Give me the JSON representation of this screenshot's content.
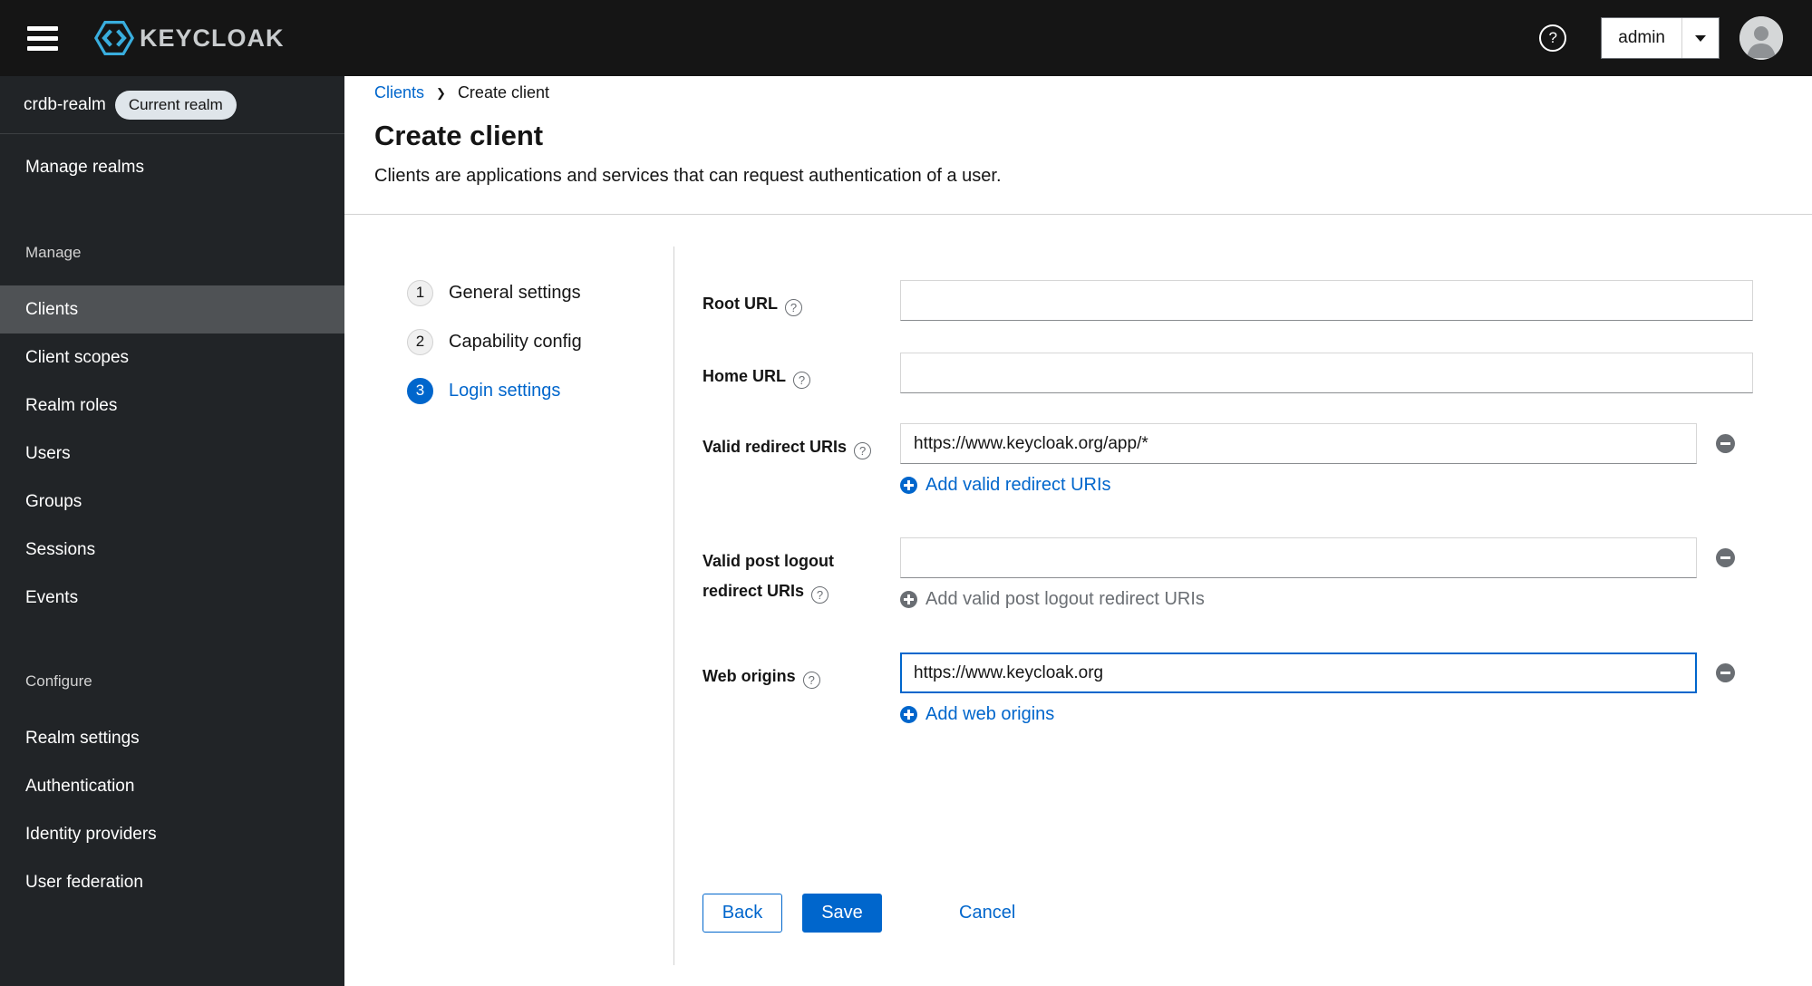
{
  "header": {
    "brand": "KEYCLOAK",
    "user_menu": {
      "label": "admin"
    }
  },
  "sidebar": {
    "realm": {
      "name": "crdb-realm",
      "badge": "Current realm"
    },
    "manage_realms_label": "Manage realms",
    "groups": [
      {
        "label": "Manage",
        "items": [
          {
            "label": "Clients",
            "active": true
          },
          {
            "label": "Client scopes",
            "active": false
          },
          {
            "label": "Realm roles",
            "active": false
          },
          {
            "label": "Users",
            "active": false
          },
          {
            "label": "Groups",
            "active": false
          },
          {
            "label": "Sessions",
            "active": false
          },
          {
            "label": "Events",
            "active": false
          }
        ]
      },
      {
        "label": "Configure",
        "items": [
          {
            "label": "Realm settings",
            "active": false
          },
          {
            "label": "Authentication",
            "active": false
          },
          {
            "label": "Identity providers",
            "active": false
          },
          {
            "label": "User federation",
            "active": false
          }
        ]
      }
    ]
  },
  "breadcrumb": {
    "parent": "Clients",
    "current": "Create client"
  },
  "page": {
    "title": "Create client",
    "subtitle": "Clients are applications and services that can request authentication of a user."
  },
  "wizard": {
    "steps": [
      {
        "number": "1",
        "label": "General settings",
        "current": false
      },
      {
        "number": "2",
        "label": "Capability config",
        "current": false
      },
      {
        "number": "3",
        "label": "Login settings",
        "current": true
      }
    ]
  },
  "form": {
    "fields": [
      {
        "label": "Root URL",
        "value": ""
      },
      {
        "label": "Home URL",
        "value": ""
      },
      {
        "label": "Valid redirect URIs",
        "value": "https://www.keycloak.org/app/*",
        "add_label": "Add valid redirect URIs",
        "add_enabled": true
      },
      {
        "label": "Valid post logout redirect URIs",
        "value": "",
        "add_label": "Add valid post logout redirect URIs",
        "add_enabled": false
      },
      {
        "label": "Web origins",
        "value": "https://www.keycloak.org",
        "add_label": "Add web origins",
        "add_enabled": true,
        "focused": true
      }
    ]
  },
  "actions": {
    "back": "Back",
    "save": "Save",
    "cancel": "Cancel"
  },
  "colors": {
    "accent": "#0066cc",
    "masthead": "#151515",
    "sidebar": "#212427",
    "sidebar_active": "#4f5255",
    "muted": "#6a6e73"
  }
}
